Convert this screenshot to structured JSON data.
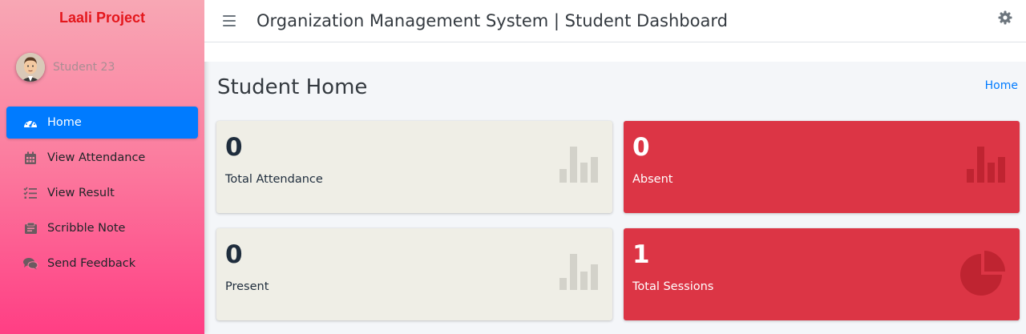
{
  "brand": "Laali Project",
  "user": {
    "name": "Student 23"
  },
  "nav": [
    {
      "label": "Home",
      "icon": "dashboard-icon",
      "active": true
    },
    {
      "label": "View Attendance",
      "icon": "calendar-icon"
    },
    {
      "label": "View Result",
      "icon": "checklist-icon"
    },
    {
      "label": "Scribble Note",
      "icon": "note-icon"
    },
    {
      "label": "Send Feedback",
      "icon": "comments-icon"
    }
  ],
  "header": {
    "title": "Organization Management System | Student Dashboard"
  },
  "page": {
    "title": "Student Home",
    "breadcrumb": "Home"
  },
  "boxes": [
    {
      "value": "0",
      "label": "Total Attendance",
      "icon": "bar-chart-icon",
      "color": "#efeee6"
    },
    {
      "value": "0",
      "label": "Absent",
      "icon": "bar-chart-icon",
      "color": "#dc3545"
    },
    {
      "value": "0",
      "label": "Present",
      "icon": "bar-chart-icon",
      "color": "#efeee6"
    },
    {
      "value": "1",
      "label": "Total Sessions",
      "icon": "pie-chart-icon",
      "color": "#dc3545"
    }
  ],
  "colors": {
    "accent": "#007bff",
    "danger": "#dc3545",
    "brand": "#e4161b"
  }
}
